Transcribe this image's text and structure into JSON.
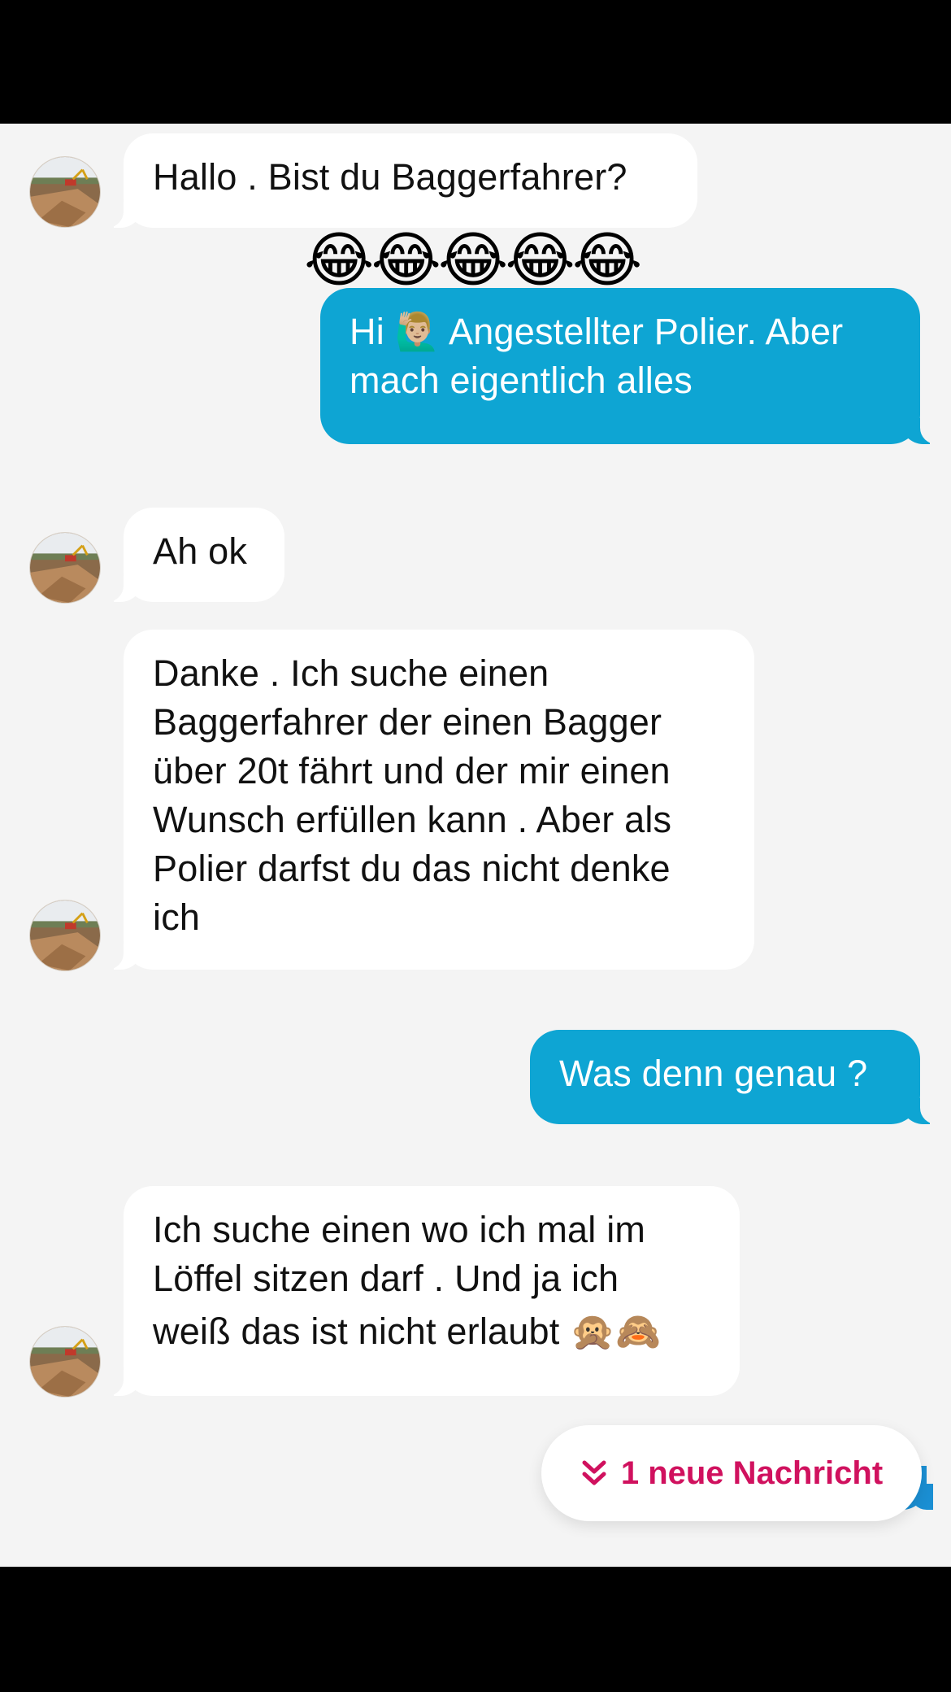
{
  "messages": [
    {
      "direction": "incoming",
      "text": "Hallo . Bist du Baggerfahrer?",
      "reaction": "😂😂😂😂😂"
    },
    {
      "direction": "outgoing",
      "line1": "Hi 🙋🏼‍♂️ Angestellter Polier. Aber",
      "line2": "mach eigentlich alles"
    },
    {
      "direction": "incoming",
      "text": "Ah ok"
    },
    {
      "direction": "incoming",
      "lines": [
        "Danke . Ich suche einen",
        "Baggerfahrer der einen Bagger",
        "über 20t fährt und der mir einen",
        "Wunsch erfüllen kann . Aber als",
        "Polier darfst du das nicht denke",
        "ich"
      ]
    },
    {
      "direction": "outgoing",
      "text": "Was denn genau ?"
    },
    {
      "direction": "incoming",
      "lines": [
        "Ich suche einen wo ich mal im",
        "Löffel sitzen darf . Und ja ich",
        "weiß das ist nicht erlaubt 🙊🙈"
      ]
    }
  ],
  "new_message_pill": {
    "label": "1 neue Nachricht",
    "icon": "double-chevron-down-icon"
  },
  "colors": {
    "outgoing": "#0ea5d3",
    "incoming": "#ffffff",
    "background": "#f4f4f4",
    "accent": "#d0115e"
  }
}
